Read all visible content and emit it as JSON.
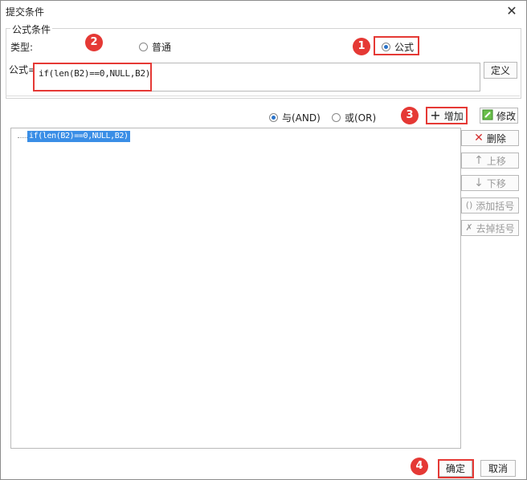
{
  "window": {
    "title": "提交条件"
  },
  "group": {
    "title": "公式条件"
  },
  "type_row": {
    "label": "类型:",
    "option_normal": "普通",
    "option_formula": "公式",
    "selected": "公式"
  },
  "formula_row": {
    "label": "公式=",
    "value": "if(len(B2)==0,NULL,B2)",
    "define_button": "定义"
  },
  "logic": {
    "and_label": "与(AND)",
    "or_label": "或(OR)",
    "selected": "与(AND)"
  },
  "actions": {
    "add": "增加",
    "modify": "修改",
    "delete": "删除",
    "move_up": "上移",
    "move_down": "下移",
    "add_bracket": "添加括号",
    "remove_bracket": "去掉括号"
  },
  "conditions": [
    {
      "text": "if(len(B2)==0,NULL,B2)",
      "selected": true
    }
  ],
  "footer": {
    "ok": "确定",
    "cancel": "取消"
  },
  "annotations": [
    "1",
    "2",
    "3",
    "4"
  ],
  "colors": {
    "highlight": "#e53935",
    "selection": "#3a8ee6",
    "radio_on": "#2a73c9"
  }
}
